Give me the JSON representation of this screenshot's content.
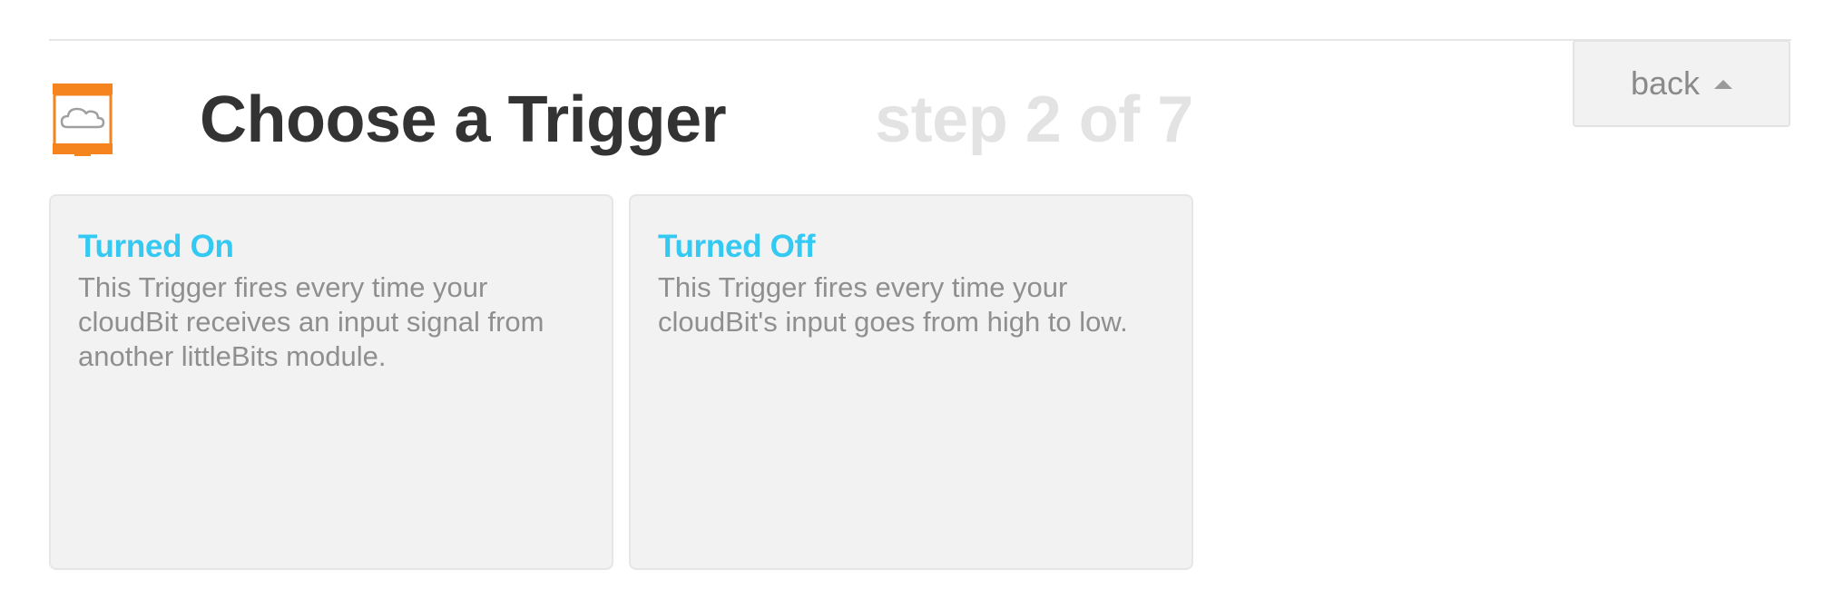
{
  "header": {
    "title": "Choose a Trigger",
    "step": "step 2 of 7",
    "service_icon": "littlebits-cloudbit-icon"
  },
  "back_button": {
    "label": "back",
    "icon": "caret-up-icon"
  },
  "triggers": [
    {
      "title": "Turned On",
      "description": "This Trigger fires every time your cloudBit receives an input signal from another littleBits module."
    },
    {
      "title": "Turned Off",
      "description": "This Trigger fires every time your cloudBit's input goes from high to low."
    }
  ],
  "colors": {
    "accent": "#33c9f2",
    "title": "#333333",
    "step": "#e3e3e3",
    "card_bg": "#f2f2f2",
    "icon_orange": "#f5841f"
  }
}
